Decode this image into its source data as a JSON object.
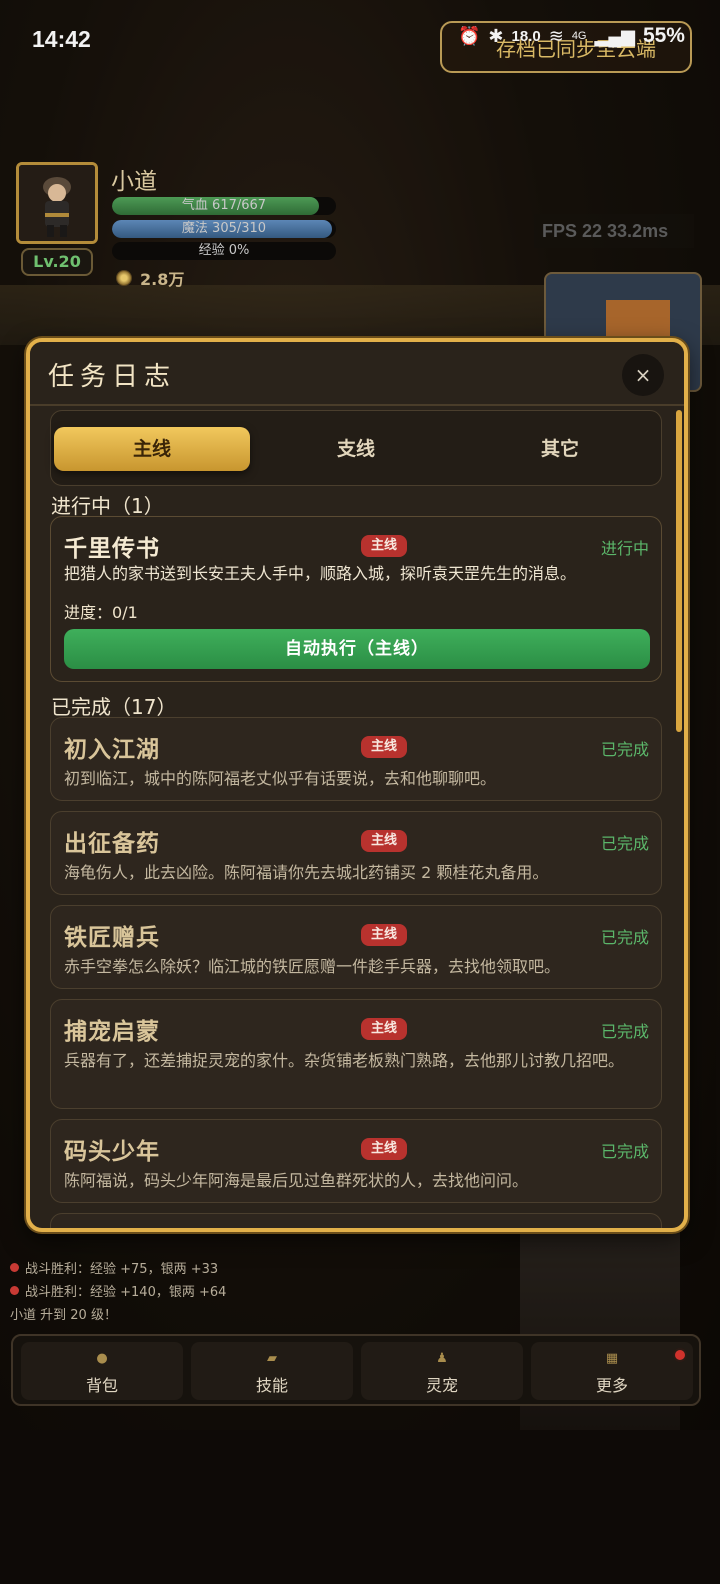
{
  "status_bar": {
    "time": "14:42",
    "net_speed": "18.0",
    "net_unit": "KB/s",
    "network": "4G",
    "battery": "55%"
  },
  "toast": {
    "text": "存档已同步至云端"
  },
  "player": {
    "name": "小道",
    "level": "Lv.20",
    "hp_text": "气血 617/667",
    "hp_fraction": 0.925,
    "mp_text": "魔法 305/310",
    "mp_fraction": 0.984,
    "xp_text": "经验 0%",
    "xp_fraction": 0.0,
    "gold": "2.8万"
  },
  "fps": {
    "text": "FPS 22  33.2ms"
  },
  "modal": {
    "title": "任务日志",
    "close": "×",
    "tabs": [
      {
        "label": "主线",
        "active": true
      },
      {
        "label": "支线",
        "active": false
      },
      {
        "label": "其它",
        "active": false
      }
    ],
    "in_progress_label": "进行中（1）",
    "active_quest": {
      "title": "千里传书",
      "badge": "主线",
      "state": "进行中",
      "desc": "把猎人的家书送到长安王夫人手中，顺路入城，探听袁天罡先生的消息。",
      "progress": "进度：0/1",
      "button": "自动执行（主线）"
    },
    "completed_label": "已完成（17）",
    "completed_quests": [
      {
        "title": "初入江湖",
        "badge": "主线",
        "state": "已完成",
        "desc": "初到临江，城中的陈阿福老丈似乎有话要说，去和他聊聊吧。"
      },
      {
        "title": "出征备药",
        "badge": "主线",
        "state": "已完成",
        "desc": "海龟伤人，此去凶险。陈阿福请你先去城北药铺买 2 颗桂花丸备用。"
      },
      {
        "title": "铁匠赠兵",
        "badge": "主线",
        "state": "已完成",
        "desc": "赤手空拳怎么除妖？临江城的铁匠愿赠一件趁手兵器，去找他领取吧。"
      },
      {
        "title": "捕宠启蒙",
        "badge": "主线",
        "state": "已完成",
        "desc": "兵器有了，还差捕捉灵宠的家什。杂货铺老板熟门熟路，去他那儿讨教几招吧。"
      },
      {
        "title": "码头少年",
        "badge": "主线",
        "state": "已完成",
        "desc": "陈阿福说，码头少年阿海是最后见过鱼群死状的人，去找他问问。"
      }
    ]
  },
  "battle_log": [
    {
      "text": "战斗胜利：经验 +75，银两 +33",
      "kind": "battle"
    },
    {
      "text": "战斗胜利：经验 +140，银两 +64",
      "kind": "battle"
    },
    {
      "text": "小道 升到 20 级！",
      "kind": "level"
    }
  ],
  "bottom_nav": [
    {
      "label": "背包",
      "icon": "bag-icon"
    },
    {
      "label": "技能",
      "icon": "book-icon"
    },
    {
      "label": "灵宠",
      "icon": "pet-icon"
    },
    {
      "label": "更多",
      "icon": "grid-icon"
    }
  ],
  "colors": {
    "accent_gold": "#e2b04a",
    "badge_red": "#b8322e",
    "success_green": "#5bb66a",
    "button_green": "#3faf5b"
  }
}
